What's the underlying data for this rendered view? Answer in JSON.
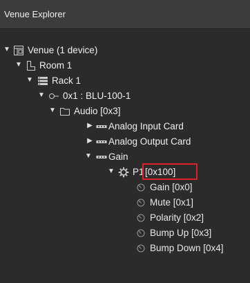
{
  "window": {
    "title": "Venue Explorer"
  },
  "tree": {
    "venue": "Venue (1 device)",
    "room": "Room 1",
    "rack": "Rack 1",
    "device": "0x1 : BLU-100-1",
    "audio": "Audio [0x3]",
    "analog_input": "Analog Input Card",
    "analog_output": "Analog Output Card",
    "gain": "Gain",
    "p1_name": "P1",
    "p1_addr": "[0x100]",
    "params": [
      "Gain [0x0]",
      "Mute [0x1]",
      "Polarity [0x2]",
      "Bump Up [0x3]",
      "Bump Down [0x4]"
    ]
  },
  "colors": {
    "background": "#2b2b2b",
    "highlight": "#e0202a"
  },
  "icons": {
    "venue": "venue-icon",
    "room": "room-icon",
    "rack": "rack-icon",
    "device": "device-icon",
    "folder": "folder-icon",
    "card": "card-icon",
    "processing_object": "gear-icon",
    "parameter": "parameter-icon"
  }
}
